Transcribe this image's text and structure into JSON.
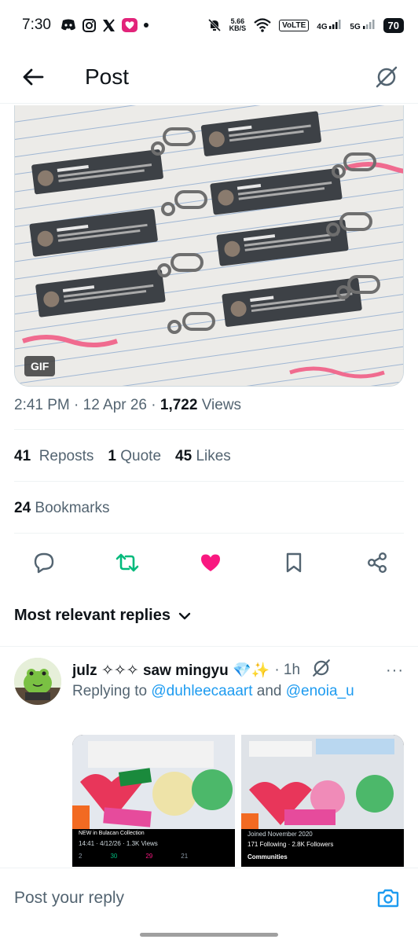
{
  "status_bar": {
    "time": "7:30",
    "speed_value": "5.66",
    "speed_unit": "KB/S",
    "volte": "VoLTE",
    "net4g": "4G",
    "net5g": "5G",
    "battery": "70"
  },
  "header": {
    "title": "Post"
  },
  "media": {
    "badge": "GIF"
  },
  "meta": {
    "time": "2:41 PM",
    "date": "12 Apr 26",
    "views_count": "1,722",
    "views_label": "Views"
  },
  "stats": {
    "reposts_count": "41",
    "reposts_label": "Reposts",
    "quotes_count": "1",
    "quotes_label": "Quote",
    "likes_count": "45",
    "likes_label": "Likes",
    "bookmarks_count": "24",
    "bookmarks_label": "Bookmarks"
  },
  "replies_filter": {
    "label": "Most relevant replies"
  },
  "reply": {
    "name": "julz ✧✧✧ saw mingyu 💎✨",
    "time": "· 1h",
    "more": "···",
    "replying_prefix": "Replying to",
    "mention1": "@duhleecaaart",
    "and": "and",
    "mention2": "@enoia_u",
    "left_caption": "NEW in Bulacan Collection",
    "left_footer": "14:41 · 4/12/26 · 1.3K Views",
    "left_counts": [
      "2",
      "30",
      "29",
      "21"
    ],
    "right_joined": "Joined November 2020",
    "right_following": "171 Following · 2.8K Followers",
    "right_communities": "Communities"
  },
  "composer": {
    "placeholder": "Post your reply"
  },
  "colors": {
    "accent": "#1d9bf0",
    "repost_green": "#00ba7c",
    "like_pink": "#f91880",
    "text_secondary": "#536471"
  }
}
